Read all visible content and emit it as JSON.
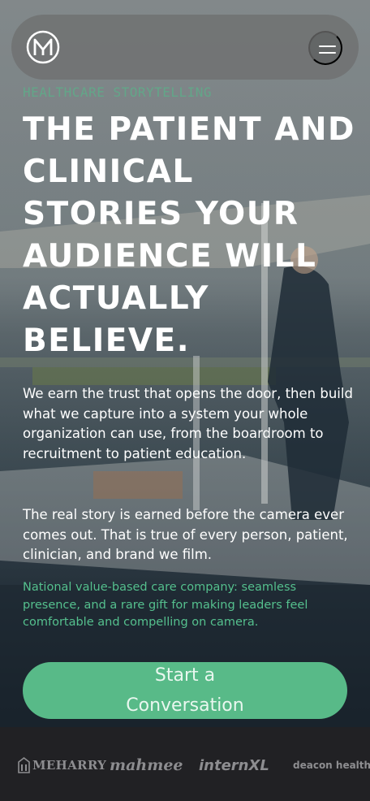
{
  "header": {
    "logo_letter": "M",
    "menu_icon": "hamburger-icon"
  },
  "hero": {
    "eyebrow": "HEALTHCARE STORYTELLING",
    "headline": "THE PATIENT AND CLINICAL STORIES YOUR AUDIENCE WILL ACTUALLY BELIEVE.",
    "paragraph_1": "We earn the trust that opens the door, then build what we capture into a system your whole organization can use, from the boardroom to recruitment to patient education.",
    "paragraph_2": "The real story is earned before the camera ever comes out. That is true of every person, patient, clinician, and brand we film.",
    "testimonial": "National value-based care company: seamless presence, and a rare gift for making leaders feel comfortable and compelling on camera.",
    "cta_label": "Start a Conversation"
  },
  "clients": {
    "logos": [
      "MEHARRY",
      "mahmee",
      "internXL",
      "deacon health"
    ]
  },
  "colors": {
    "accent": "#58ba88",
    "strip": "#212124"
  }
}
